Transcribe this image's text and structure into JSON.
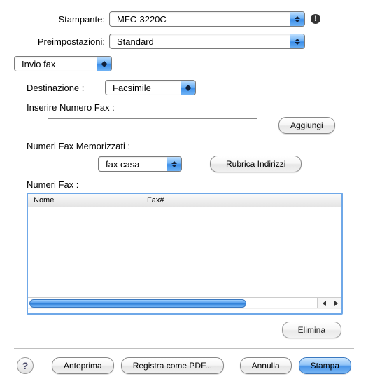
{
  "printer": {
    "label": "Stampante:",
    "value": "MFC-3220C"
  },
  "presets": {
    "label": "Preimpostazioni:",
    "value": "Standard"
  },
  "paneSelect": {
    "value": "Invio fax"
  },
  "destination": {
    "label": "Destinazione :",
    "value": "Facsimile"
  },
  "faxNumberInput": {
    "label": "Inserire Numero Fax :",
    "value": ""
  },
  "addButton": "Aggiungi",
  "storedNumbers": {
    "label": "Numeri Fax Memorizzati :",
    "value": "fax casa"
  },
  "addressBookButton": "Rubrica Indirizzi",
  "faxListLabel": "Numeri Fax :",
  "columns": {
    "name": "Nome",
    "fax": "Fax#"
  },
  "deleteButton": "Elimina",
  "helpGlyph": "?",
  "bottomButtons": {
    "preview": "Anteprima",
    "saveAsPdf": "Registra come PDF...",
    "cancel": "Annulla",
    "print": "Stampa"
  }
}
